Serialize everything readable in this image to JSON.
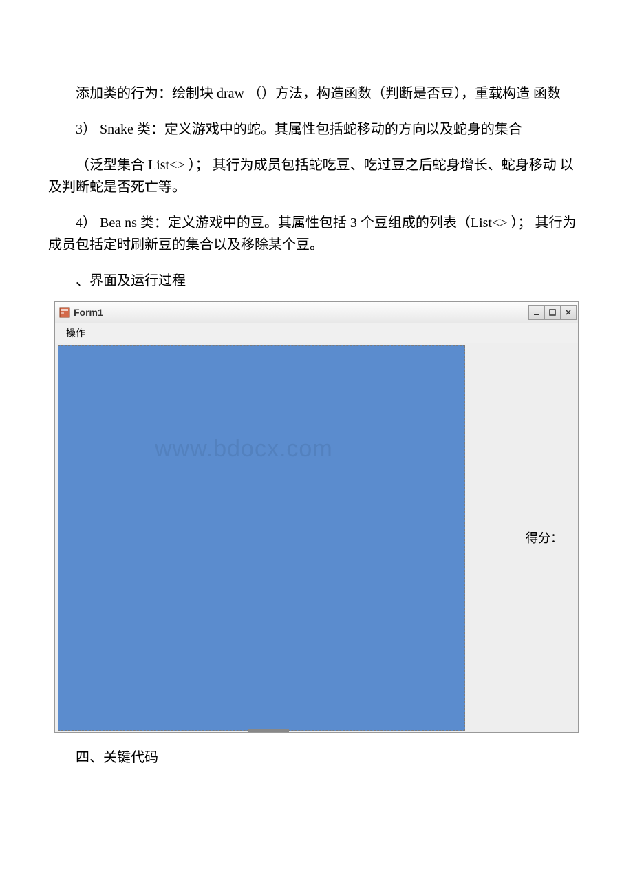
{
  "paragraphs": {
    "p1": "添加类的行为：绘制块 draw （）方法，构造函数（判断是否豆），重载构造 函数",
    "p2": "3） Snake 类：定义游戏中的蛇。其属性包括蛇移动的方向以及蛇身的集合",
    "p3": "（泛型集合 List<> ）； 其行为成员包括蛇吃豆、吃过豆之后蛇身增长、蛇身移动 以及判断蛇是否死亡等。",
    "p4": "4） Bea ns 类：定义游戏中的豆。其属性包括 3 个豆组成的列表（List<> ）； 其行为成员包括定时刷新豆的集合以及移除某个豆。",
    "p5": "、界面及运行过程",
    "p6": "四、关键代码"
  },
  "form": {
    "title": "Form1",
    "menu": {
      "operation": "操作"
    },
    "scoreLabel": "得分：",
    "watermark": "www.bdocx.com",
    "windowControls": {
      "minimize": "_",
      "maximize": "□",
      "close": "×"
    }
  }
}
